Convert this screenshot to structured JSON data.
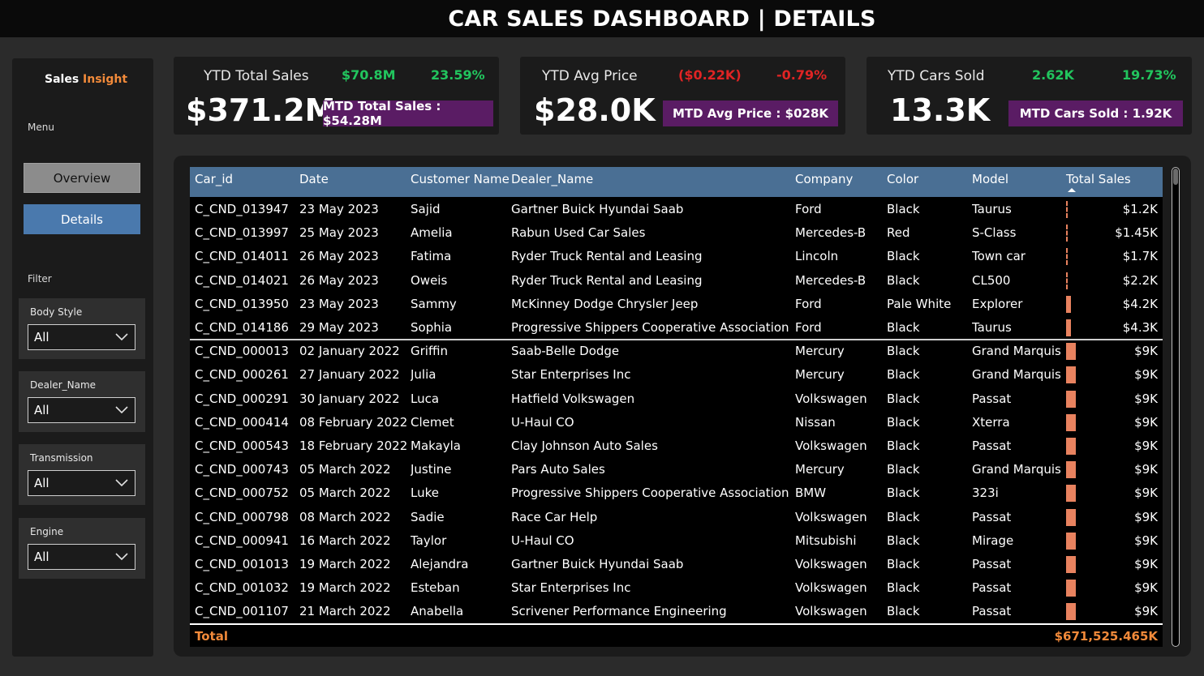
{
  "title": "CAR SALES DASHBOARD | DETAILS",
  "sidebar": {
    "brand_a": "Sales",
    "brand_b": "Insight",
    "menu_label": "Menu",
    "nav": {
      "overview": "Overview",
      "details": "Details"
    },
    "filter_label": "Filter",
    "filters": [
      {
        "label": "Body Style",
        "value": "All"
      },
      {
        "label": "Dealer_Name",
        "value": "All"
      },
      {
        "label": "Transmission",
        "value": "All"
      },
      {
        "label": "Engine",
        "value": "All"
      }
    ]
  },
  "kpis": [
    {
      "label": "YTD Total Sales",
      "value": "$371.2M",
      "delta_abs": "$70.8M",
      "delta_pct": "23.59%",
      "trend": "up",
      "mtd": "MTD Total Sales : $54.28M"
    },
    {
      "label": "YTD Avg Price",
      "value": "$28.0K",
      "delta_abs": "($0.22K)",
      "delta_pct": "-0.79%",
      "trend": "down",
      "mtd": "MTD Avg Price : $028K"
    },
    {
      "label": "YTD Cars Sold",
      "value": "13.3K",
      "delta_abs": "2.62K",
      "delta_pct": "19.73%",
      "trend": "up",
      "mtd": "MTD Cars Sold : 1.92K"
    }
  ],
  "colors": {
    "accent_orange": "#f28a3a",
    "bar": "#e8825f",
    "header": "#4a6f94",
    "mtd_bg": "#5a1c64",
    "up": "#22c55e",
    "down": "#e02424"
  },
  "table": {
    "columns": [
      "Car_id",
      "Date",
      "Customer Name",
      "Dealer_Name",
      "Company",
      "Color",
      "Model",
      "Total Sales"
    ],
    "sort_column": "Total Sales",
    "sort_direction": "ascending",
    "rows": [
      {
        "car_id": "C_CND_013947",
        "date": "23 May 2023",
        "customer": "Sajid",
        "dealer": "Gartner Buick Hyundai Saab",
        "company": "Ford",
        "color": "Black",
        "model": "Taurus",
        "total": "$1.2K",
        "amount": 1.2
      },
      {
        "car_id": "C_CND_013997",
        "date": "25 May 2023",
        "customer": "Amelia",
        "dealer": "Rabun Used Car Sales",
        "company": "Mercedes-B",
        "color": "Red",
        "model": "S-Class",
        "total": "$1.45K",
        "amount": 1.45
      },
      {
        "car_id": "C_CND_014011",
        "date": "26 May 2023",
        "customer": "Fatima",
        "dealer": "Ryder Truck Rental and Leasing",
        "company": "Lincoln",
        "color": "Black",
        "model": "Town car",
        "total": "$1.7K",
        "amount": 1.7
      },
      {
        "car_id": "C_CND_014021",
        "date": "26 May 2023",
        "customer": "Oweis",
        "dealer": "Ryder Truck Rental and Leasing",
        "company": "Mercedes-B",
        "color": "Black",
        "model": "CL500",
        "total": "$2.2K",
        "amount": 2.2
      },
      {
        "car_id": "C_CND_013950",
        "date": "23 May 2023",
        "customer": "Sammy",
        "dealer": "McKinney Dodge Chrysler Jeep",
        "company": "Ford",
        "color": "Pale White",
        "model": "Explorer",
        "total": "$4.2K",
        "amount": 4.2
      },
      {
        "car_id": "C_CND_014186",
        "date": "29 May 2023",
        "customer": "Sophia",
        "dealer": "Progressive Shippers Cooperative Association No",
        "company": "Ford",
        "color": "Black",
        "model": "Taurus",
        "total": "$4.3K",
        "amount": 4.3
      },
      {
        "car_id": "C_CND_000013",
        "date": "02 January 2022",
        "customer": "Griffin",
        "dealer": "Saab-Belle Dodge",
        "company": "Mercury",
        "color": "Black",
        "model": "Grand Marquis",
        "total": "$9K",
        "amount": 9
      },
      {
        "car_id": "C_CND_000261",
        "date": "27 January 2022",
        "customer": "Julia",
        "dealer": "Star Enterprises Inc",
        "company": "Mercury",
        "color": "Black",
        "model": "Grand Marquis",
        "total": "$9K",
        "amount": 9
      },
      {
        "car_id": "C_CND_000291",
        "date": "30 January 2022",
        "customer": "Luca",
        "dealer": "Hatfield Volkswagen",
        "company": "Volkswagen",
        "color": "Black",
        "model": "Passat",
        "total": "$9K",
        "amount": 9
      },
      {
        "car_id": "C_CND_000414",
        "date": "08 February 2022",
        "customer": "Clemet",
        "dealer": "U-Haul CO",
        "company": "Nissan",
        "color": "Black",
        "model": "Xterra",
        "total": "$9K",
        "amount": 9
      },
      {
        "car_id": "C_CND_000543",
        "date": "18 February 2022",
        "customer": "Makayla",
        "dealer": "Clay Johnson Auto Sales",
        "company": "Volkswagen",
        "color": "Black",
        "model": "Passat",
        "total": "$9K",
        "amount": 9
      },
      {
        "car_id": "C_CND_000743",
        "date": "05 March 2022",
        "customer": "Justine",
        "dealer": "Pars Auto Sales",
        "company": "Mercury",
        "color": "Black",
        "model": "Grand Marquis",
        "total": "$9K",
        "amount": 9
      },
      {
        "car_id": "C_CND_000752",
        "date": "05 March 2022",
        "customer": "Luke",
        "dealer": "Progressive Shippers Cooperative Association No",
        "company": "BMW",
        "color": "Black",
        "model": "323i",
        "total": "$9K",
        "amount": 9
      },
      {
        "car_id": "C_CND_000798",
        "date": "08 March 2022",
        "customer": "Sadie",
        "dealer": "Race Car Help",
        "company": "Volkswagen",
        "color": "Black",
        "model": "Passat",
        "total": "$9K",
        "amount": 9
      },
      {
        "car_id": "C_CND_000941",
        "date": "16 March 2022",
        "customer": "Taylor",
        "dealer": "U-Haul CO",
        "company": "Mitsubishi",
        "color": "Black",
        "model": "Mirage",
        "total": "$9K",
        "amount": 9
      },
      {
        "car_id": "C_CND_001013",
        "date": "19 March 2022",
        "customer": "Alejandra",
        "dealer": "Gartner Buick Hyundai Saab",
        "company": "Volkswagen",
        "color": "Black",
        "model": "Passat",
        "total": "$9K",
        "amount": 9
      },
      {
        "car_id": "C_CND_001032",
        "date": "19 March 2022",
        "customer": "Esteban",
        "dealer": "Star Enterprises Inc",
        "company": "Volkswagen",
        "color": "Black",
        "model": "Passat",
        "total": "$9K",
        "amount": 9
      },
      {
        "car_id": "C_CND_001107",
        "date": "21 March 2022",
        "customer": "Anabella",
        "dealer": "Scrivener Performance Engineering",
        "company": "Volkswagen",
        "color": "Black",
        "model": "Passat",
        "total": "$9K",
        "amount": 9
      }
    ],
    "total_label": "Total",
    "total_value": "$671,525.465K"
  }
}
